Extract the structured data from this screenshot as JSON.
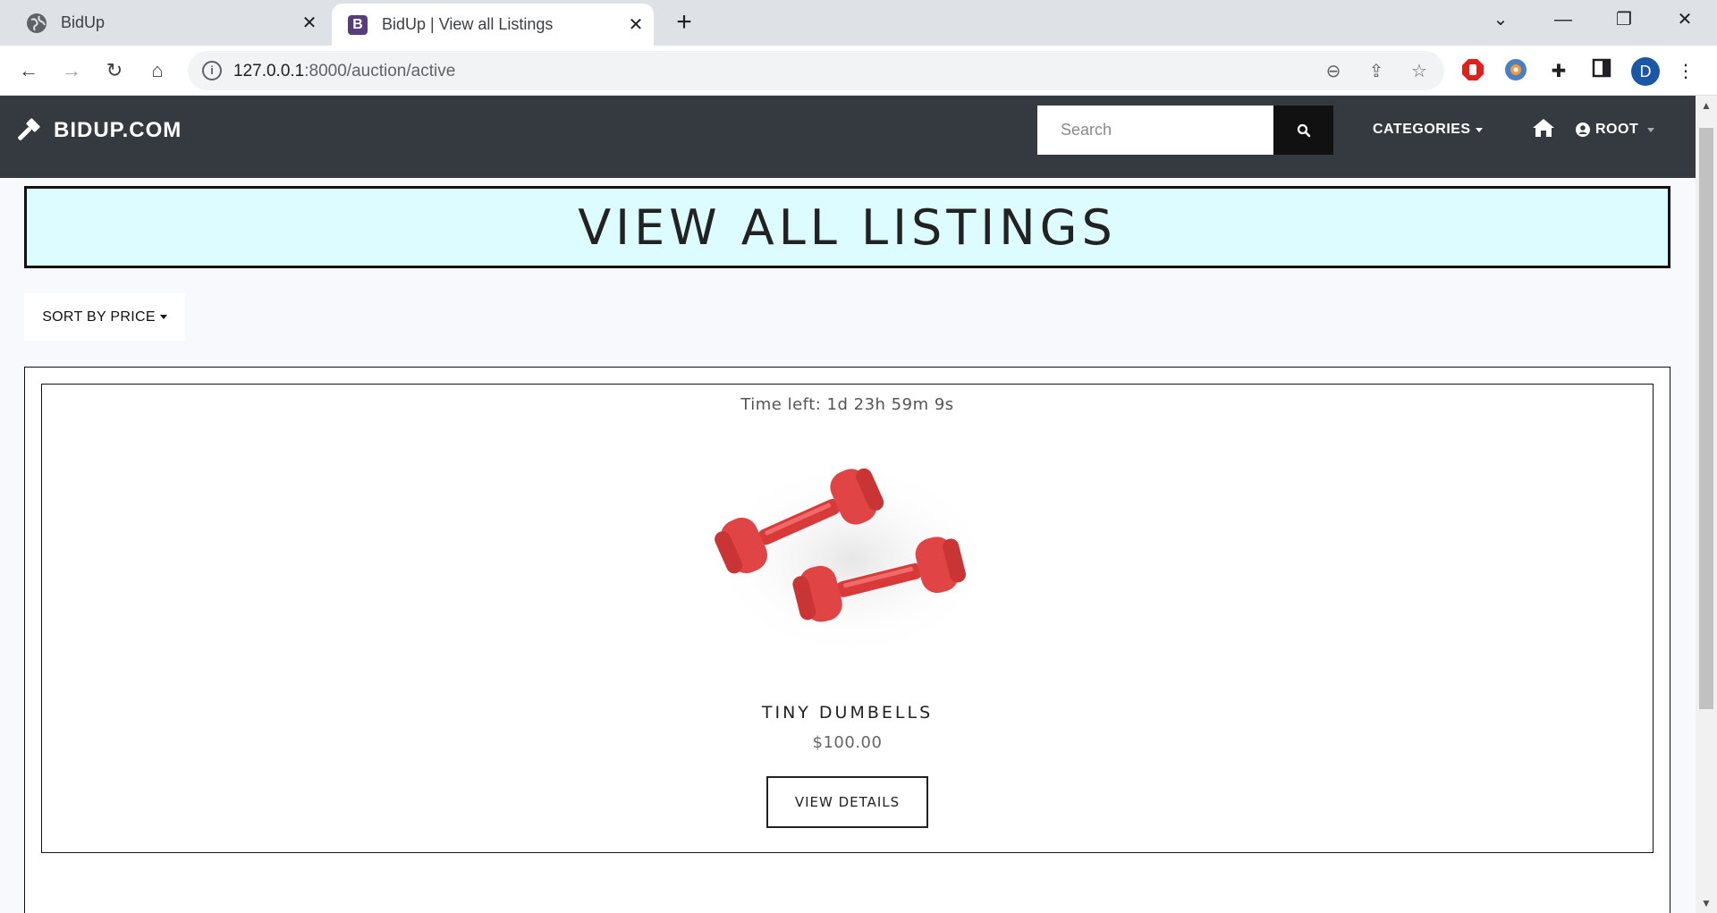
{
  "browser": {
    "tabs": [
      {
        "title": "BidUp",
        "favicon": "globe-icon",
        "active": false
      },
      {
        "title": "BidUp | View all Listings",
        "favicon": "bootstrap-b-icon",
        "active": true
      }
    ],
    "url_host": "127.0.0.1",
    "url_path": ":8000/auction/active",
    "profile_initial": "D"
  },
  "navbar": {
    "brand": "BIDUP.COM",
    "search_placeholder": "Search",
    "categories_label": "CATEGORIES",
    "user_label": "ROOT",
    "bg_color": "#343a40"
  },
  "page": {
    "heading": "VIEW ALL LISTINGS",
    "heading_bg": "#ddfcff",
    "sort_label": "SORT BY PRICE"
  },
  "listings": [
    {
      "time_left": "Time left: 1d 23h 59m 9s",
      "title": "TINY DUMBELLS",
      "price": "$100.00",
      "button_label": "VIEW DETAILS",
      "image": "red-dumbbells-image"
    }
  ]
}
